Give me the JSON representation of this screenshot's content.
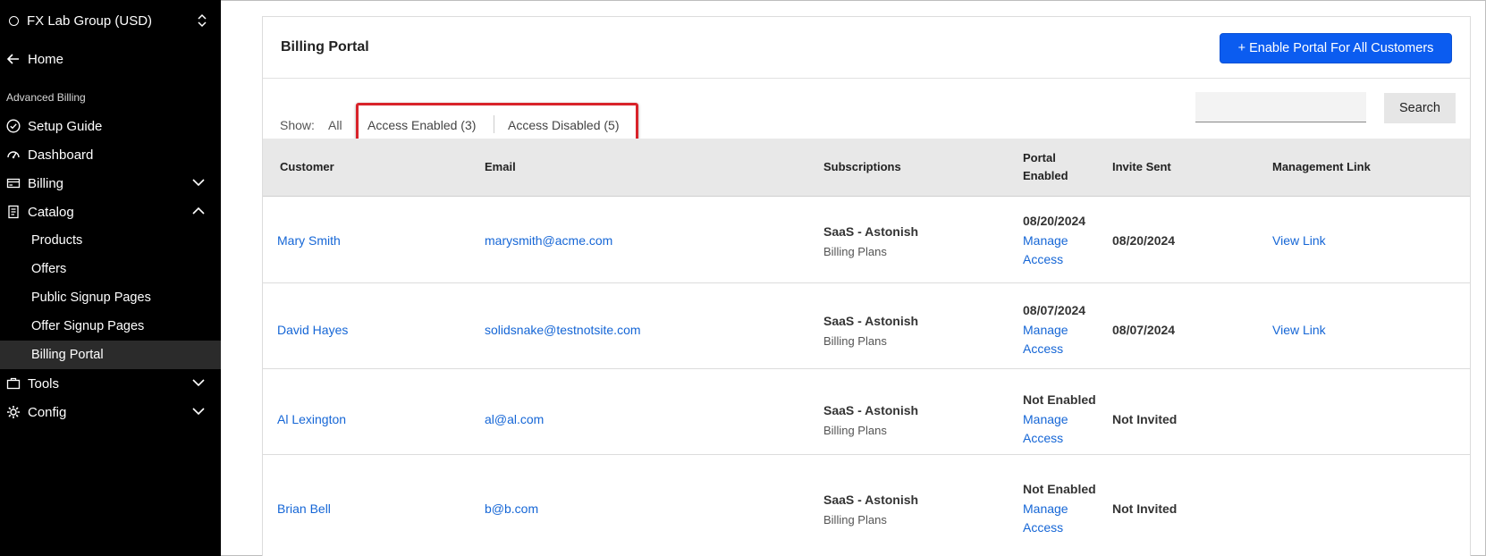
{
  "sidebar": {
    "org": "FX Lab Group (USD)",
    "home": "Home",
    "section": "Advanced Billing",
    "items": [
      {
        "label": "Setup Guide"
      },
      {
        "label": "Dashboard"
      },
      {
        "label": "Billing"
      },
      {
        "label": "Catalog"
      }
    ],
    "catalog_sub": [
      "Products",
      "Offers",
      "Public Signup Pages",
      "Offer Signup Pages",
      "Billing Portal"
    ],
    "tools": "Tools",
    "config": "Config"
  },
  "page": {
    "title": "Billing Portal",
    "enable_all_button": "+ Enable Portal For All Customers",
    "show_label": "Show:",
    "filters": {
      "all": "All",
      "enabled": "Access Enabled (3)",
      "disabled": "Access Disabled (5)"
    },
    "search_placeholder": "",
    "search_button": "Search"
  },
  "table": {
    "headers": {
      "customer": "Customer",
      "email": "Email",
      "subscriptions": "Subscriptions",
      "portal_line1": "Portal",
      "portal_line2": "Enabled",
      "invite": "Invite Sent",
      "link": "Management Link"
    },
    "rows": [
      {
        "customer": "Mary Smith",
        "email": "marysmith@acme.com",
        "sub_name": "SaaS - Astonish",
        "sub_plan": "Billing Plans",
        "portal": "08/20/2024",
        "manage1": "Manage",
        "manage2": "Access",
        "invite": "08/20/2024",
        "link": "View Link"
      },
      {
        "customer": "David Hayes",
        "email": "solidsnake@testnotsite.com",
        "sub_name": "SaaS - Astonish",
        "sub_plan": "Billing Plans",
        "portal": "08/07/2024",
        "manage1": "Manage",
        "manage2": "Access",
        "invite": "08/07/2024",
        "link": "View Link"
      },
      {
        "customer": "Al Lexington",
        "email": "al@al.com",
        "sub_name": "SaaS - Astonish",
        "sub_plan": "Billing Plans",
        "portal": "Not Enabled",
        "manage1": "Manage",
        "manage2": "Access",
        "invite": "Not Invited",
        "link": ""
      },
      {
        "customer": "Brian Bell",
        "email": "b@b.com",
        "sub_name": "SaaS - Astonish",
        "sub_plan": "Billing Plans",
        "portal": "Not Enabled",
        "manage1": "Manage",
        "manage2": "Access",
        "invite": "Not Invited",
        "link": ""
      }
    ]
  },
  "colors": {
    "accent": "#0b5cf0",
    "link": "#1566d6",
    "highlight": "#d8232a",
    "sidebar": "#000000"
  }
}
